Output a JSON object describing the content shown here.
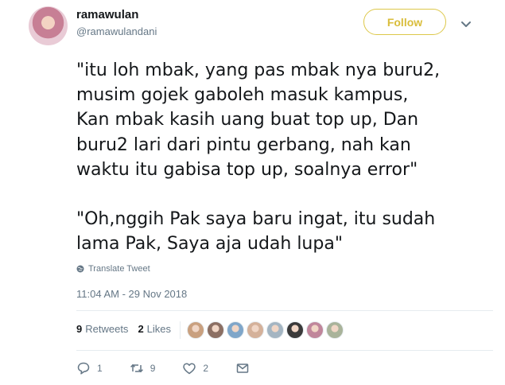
{
  "user": {
    "display_name": "ramawulan",
    "handle": "@ramawulandani",
    "avatar_icon": "profile-photo"
  },
  "follow_label": "Follow",
  "tweet": {
    "text": "\"itu loh mbak, yang pas mbak nya buru2,\nmusim gojek gaboleh masuk kampus,\nKan mbak kasih uang buat top up, Dan\nburu2 lari dari pintu gerbang, nah kan\nwaktu itu gabisa top up, soalnya error\"\n\n\"Oh,nggih Pak saya baru ingat, itu sudah\nlama Pak, Saya aja udah lupa\"",
    "translate_label": "Translate Tweet",
    "timestamp": "11:04 AM - 29 Nov 2018"
  },
  "stats": {
    "retweets_count": "9",
    "retweets_label": "Retweets",
    "likes_count": "2",
    "likes_label": "Likes"
  },
  "likers_faces": [
    "#c9a07f",
    "#8b6f63",
    "#7fa6c9",
    "#d4b19a",
    "#a4b5c2",
    "#3a3a3a",
    "#c0869b",
    "#a9b39a"
  ],
  "actions": {
    "reply_count": "1",
    "retweet_count": "9",
    "like_count": "2"
  },
  "colors": {
    "follow_accent": "#d9bd3b",
    "muted_text": "#657786"
  }
}
